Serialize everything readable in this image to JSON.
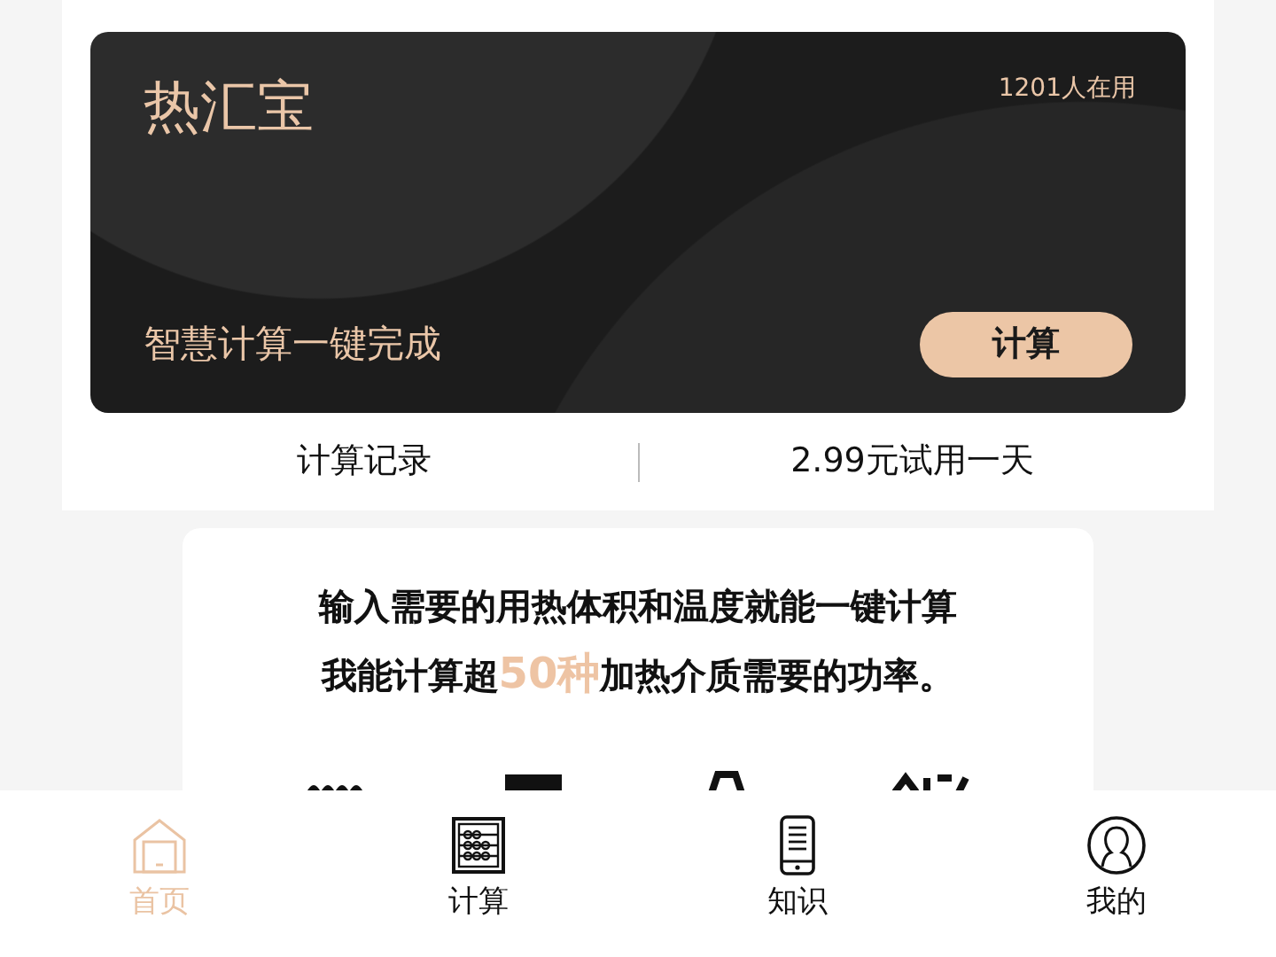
{
  "banner": {
    "title": "热汇宝",
    "users": "1201人在用",
    "slogan": "智慧计算一键完成",
    "button": "计算"
  },
  "links": [
    {
      "label": "计算记录"
    },
    {
      "label": "2.99元试用一天"
    }
  ],
  "intro": {
    "lines": [
      [
        {
          "text": "输入需要的用热体积和温度就能一键计算",
          "highlight": false
        }
      ],
      [
        {
          "text": "我能计算超",
          "highlight": false
        },
        {
          "text": "50种",
          "highlight": true
        },
        {
          "text": "加热介质需要的功率。",
          "highlight": false
        }
      ]
    ]
  },
  "tabs": [
    {
      "label": "首页",
      "kind": "home",
      "selected": true
    },
    {
      "label": "计算",
      "kind": "abacus",
      "selected": false
    },
    {
      "label": "知识",
      "kind": "phone",
      "selected": false
    },
    {
      "label": "我的",
      "kind": "user",
      "selected": false
    }
  ]
}
